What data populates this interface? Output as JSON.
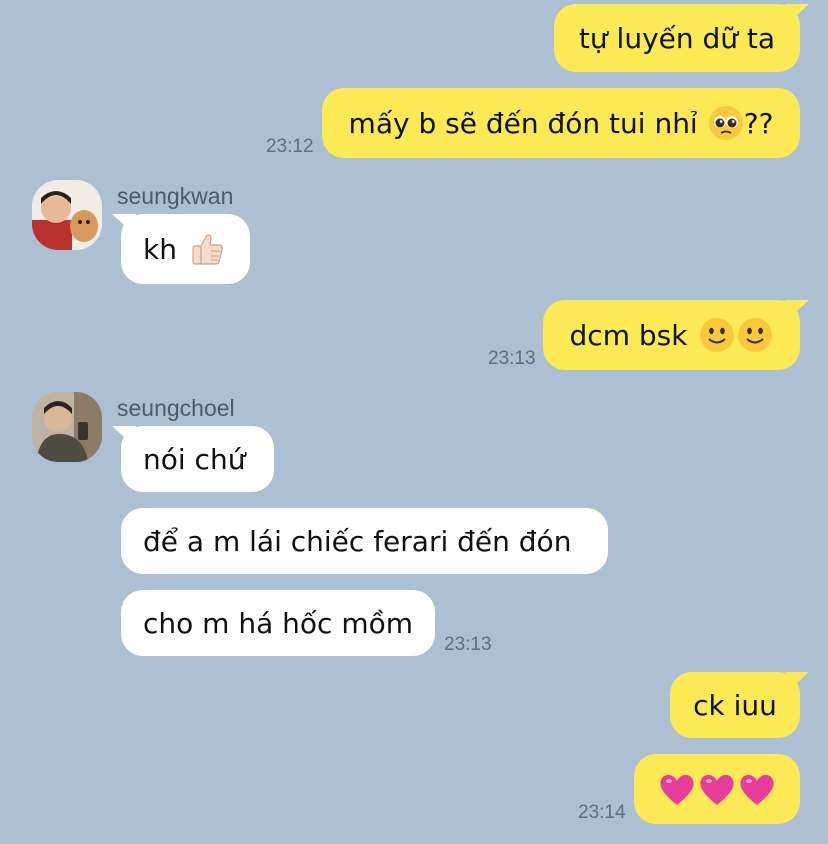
{
  "messages": [
    {
      "text": "tự luyến dữ ta"
    },
    {
      "text": "mấy b sẽ đến đón tui nhỉ",
      "suffix": "??",
      "time": "23:12"
    },
    {
      "sender": "seungkwan",
      "text": "kh"
    },
    {
      "text": "dcm bsk",
      "time": "23:13"
    },
    {
      "sender": "seungchoel",
      "text": "nói chứ"
    },
    {
      "text": "để a m lái chiếc ferari đến đón"
    },
    {
      "text": "cho m há hốc mồm",
      "time": "23:13"
    },
    {
      "text": "ck iuu"
    },
    {
      "time": "23:14"
    }
  ],
  "emoji": {
    "pleading": "pleading-face-icon",
    "thumbs": "thumbs-up-icon",
    "smile": "slightly-smiling-face-icon",
    "heart": "pink-heart-icon"
  },
  "colors": {
    "background": "#adbfd3",
    "outgoing_bubble": "#fbea56",
    "incoming_bubble": "#ffffff",
    "heart": "#e83d9c"
  }
}
